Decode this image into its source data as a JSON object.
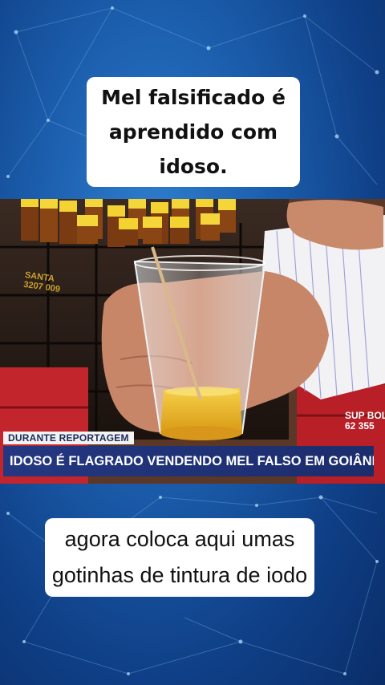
{
  "captions": {
    "top": "Mel falsificado é aprendido com idoso.",
    "bottom": "agora coloca aqui umas gotinhas de tintura de iodo"
  },
  "news": {
    "tag": "DURANTE REPORTAGEM",
    "headline": "IDOSO É FLAGRADO VENDENDO MEL FALSO EM GOIÂNIA"
  },
  "scene": {
    "crate_text": "SUP BOL\n62 355",
    "stamp_text": "SANTA\n3207 009"
  },
  "colors": {
    "background": "#1c5fae",
    "headline_bar": "#243780",
    "honey": "#e8b325",
    "crate_red": "#c2252b"
  }
}
